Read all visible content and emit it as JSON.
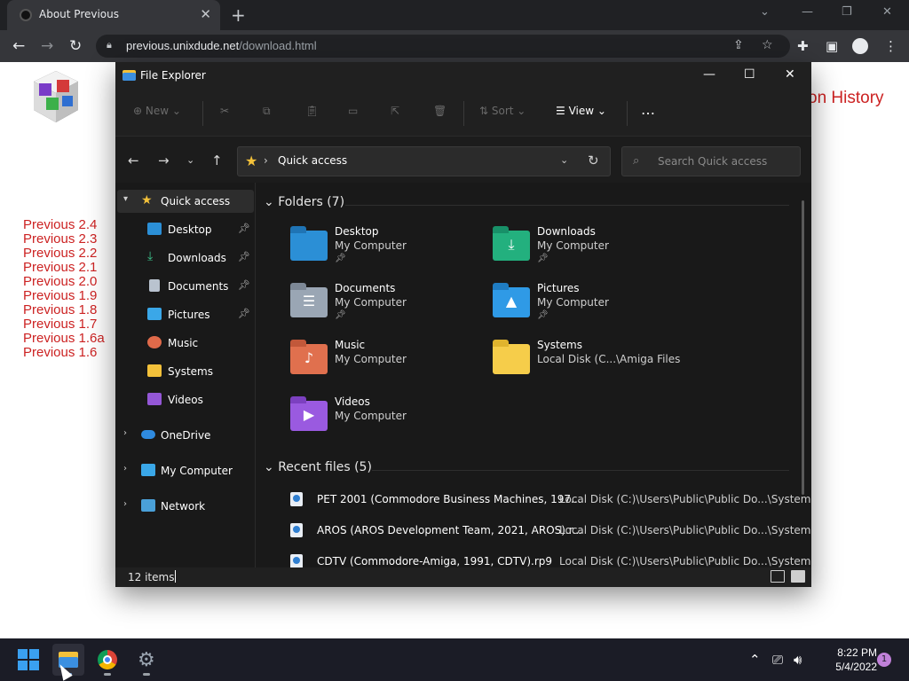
{
  "browser": {
    "tab_title": "About Previous",
    "url_host": "previous.unixdude.net",
    "url_path": "/download.html"
  },
  "page": {
    "history_link": "on History",
    "versions": [
      "Previous 2.4",
      "Previous 2.3",
      "Previous 2.2",
      "Previous 2.1",
      "Previous 2.0",
      "Previous 1.9",
      "Previous 1.8",
      "Previous 1.7",
      "Previous 1.6a",
      "Previous 1.6"
    ]
  },
  "explorer": {
    "title": "File Explorer",
    "toolbar": {
      "new": "New",
      "sort": "Sort",
      "view": "View",
      "more": "…"
    },
    "address": "Quick access",
    "search_placeholder": "Search Quick access",
    "nav": [
      {
        "label": "Quick access",
        "icon": "star-icon"
      },
      {
        "label": "Desktop",
        "icon": "desktop-icon"
      },
      {
        "label": "Downloads",
        "icon": "download-icon"
      },
      {
        "label": "Documents",
        "icon": "document-icon"
      },
      {
        "label": "Pictures",
        "icon": "pictures-icon"
      },
      {
        "label": "Music",
        "icon": "music-icon"
      },
      {
        "label": "Systems",
        "icon": "folder-icon"
      },
      {
        "label": "Videos",
        "icon": "video-icon"
      },
      {
        "label": "OneDrive",
        "icon": "cloud-icon"
      },
      {
        "label": "My Computer",
        "icon": "computer-icon"
      },
      {
        "label": "Network",
        "icon": "network-icon"
      }
    ],
    "folders_header": "Folders (7)",
    "folders": [
      {
        "name": "Desktop",
        "location": "My Computer",
        "pinned": true
      },
      {
        "name": "Downloads",
        "location": "My Computer",
        "pinned": true
      },
      {
        "name": "Documents",
        "location": "My Computer",
        "pinned": true
      },
      {
        "name": "Pictures",
        "location": "My Computer",
        "pinned": true
      },
      {
        "name": "Music",
        "location": "My Computer",
        "pinned": false
      },
      {
        "name": "Systems",
        "location": "Local Disk (C...\\Amiga Files",
        "pinned": false
      },
      {
        "name": "Videos",
        "location": "My Computer",
        "pinned": false
      }
    ],
    "recent_header": "Recent files (5)",
    "recent": [
      {
        "name": "PET 2001 (Commodore Business Machines, 197...",
        "location": "Local Disk (C:)\\Users\\Public\\Public Do...\\Systems"
      },
      {
        "name": "AROS (AROS Development Team, 2021, AROS).r...",
        "location": "Local Disk (C:)\\Users\\Public\\Public Do...\\Systems"
      },
      {
        "name": "CDTV (Commodore-Amiga, 1991, CDTV).rp9",
        "location": "Local Disk (C:)\\Users\\Public\\Public Do...\\Systems"
      }
    ],
    "status": "12 items"
  },
  "taskbar": {
    "time": "8:22 PM",
    "date": "5/4/2022",
    "notifications": "1"
  }
}
